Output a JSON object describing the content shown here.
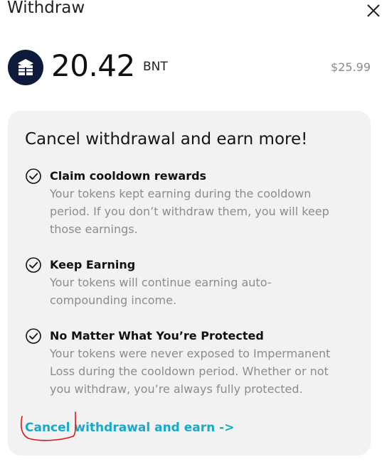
{
  "header": {
    "title": "Withdraw",
    "close_icon": "close-icon"
  },
  "token": {
    "icon": "bancor-logo-icon",
    "amount": "20.42",
    "symbol": "BNT",
    "fiat_value": "$25.99"
  },
  "card": {
    "title": "Cancel withdrawal and earn more!",
    "benefits": [
      {
        "icon": "check-circle-icon",
        "title": "Claim cooldown rewards",
        "lines": [
          "Your tokens kept earning during the cooldown",
          "period. If you don’t withdraw them, you will keep",
          "those earnings."
        ]
      },
      {
        "icon": "check-circle-icon",
        "title": "Keep Earning",
        "lines": [
          "Your tokens will continue earning auto-",
          "compounding income."
        ]
      },
      {
        "icon": "check-circle-icon",
        "title": "No Matter What You’re Protected",
        "lines": [
          "Your tokens were never exposed to Impermanent",
          "Loss during the cooldown period. Whether or not",
          "you withdraw, you’re always fully protected."
        ]
      }
    ],
    "cta_label": "Cancel withdrawal and earn ->"
  },
  "colors": {
    "accent": "#17a9c9",
    "card_background": "#f2f2f2",
    "logo_background": "#0e1a3a",
    "annotation": "#e0141a"
  }
}
